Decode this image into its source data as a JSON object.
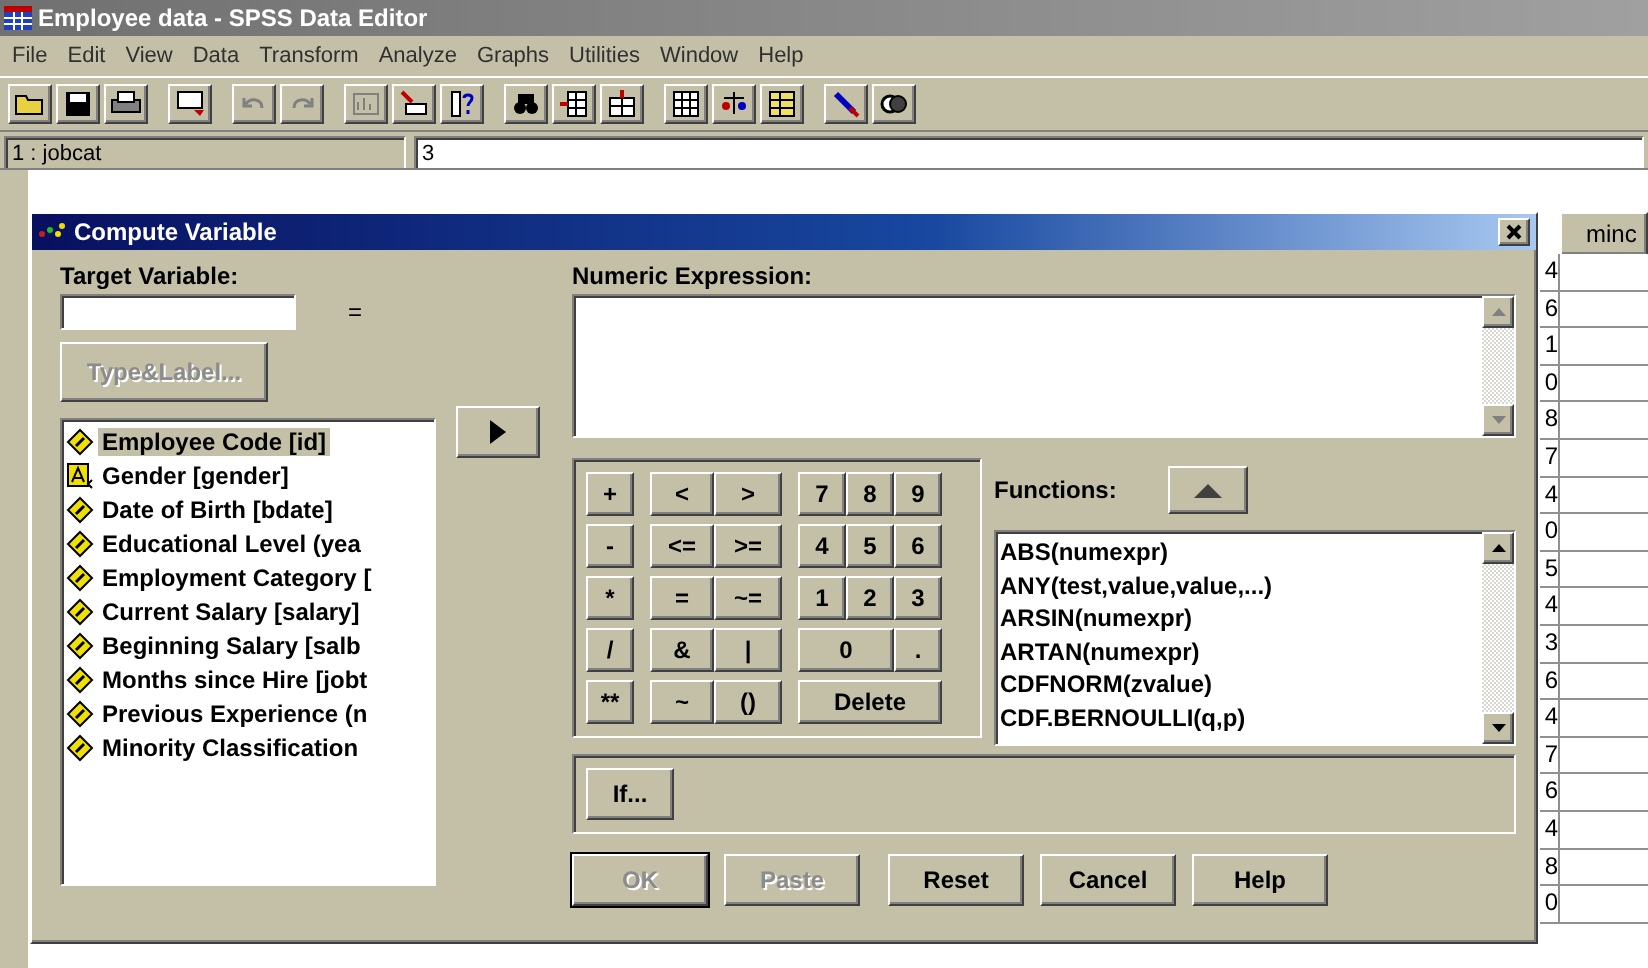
{
  "window": {
    "title": "Employee data - SPSS Data Editor"
  },
  "menu": [
    "File",
    "Edit",
    "View",
    "Data",
    "Transform",
    "Analyze",
    "Graphs",
    "Utilities",
    "Window",
    "Help"
  ],
  "cell_editor": {
    "cell_ref": "1 : jobcat",
    "value": "3"
  },
  "grid": {
    "column_header": "minc",
    "cut_column": [
      "4",
      "6",
      "1",
      "0",
      "8",
      "7",
      "4",
      "0",
      "5",
      "4",
      "3",
      "6",
      "4",
      "7",
      "6",
      "4",
      "8",
      "0"
    ]
  },
  "dialog": {
    "title": "Compute Variable",
    "target_label": "Target Variable:",
    "equals": "=",
    "type_label_button": {
      "label": "Type&Label...",
      "disabled": true
    },
    "variables": [
      {
        "label": "Employee Code [id]",
        "kind": "numeric",
        "selected": true
      },
      {
        "label": "Gender [gender]",
        "kind": "string",
        "selected": false
      },
      {
        "label": "Date of Birth [bdate]",
        "kind": "numeric",
        "selected": false
      },
      {
        "label": "Educational Level (yea",
        "kind": "numeric",
        "selected": false
      },
      {
        "label": "Employment Category [",
        "kind": "numeric",
        "selected": false
      },
      {
        "label": "Current Salary [salary]",
        "kind": "numeric",
        "selected": false
      },
      {
        "label": "Beginning Salary [salb",
        "kind": "numeric",
        "selected": false
      },
      {
        "label": "Months since Hire [jobt",
        "kind": "numeric",
        "selected": false
      },
      {
        "label": "Previous Experience (n",
        "kind": "numeric",
        "selected": false
      },
      {
        "label": "Minority Classification",
        "kind": "numeric",
        "selected": false
      }
    ],
    "expression_label": "Numeric Expression:",
    "keypad": [
      [
        "+",
        "<",
        ">",
        "7",
        "8",
        "9"
      ],
      [
        "-",
        "<=",
        ">=",
        "4",
        "5",
        "6"
      ],
      [
        "*",
        "=",
        "~=",
        "1",
        "2",
        "3"
      ],
      [
        "/",
        "&",
        "|",
        "0",
        "."
      ],
      [
        "**",
        "~",
        "()",
        "Delete"
      ]
    ],
    "functions_label": "Functions:",
    "functions": [
      "ABS(numexpr)",
      "ANY(test,value,value,...)",
      "ARSIN(numexpr)",
      "ARTAN(numexpr)",
      "CDFNORM(zvalue)",
      "CDF.BERNOULLI(q,p)"
    ],
    "if_button": "If...",
    "buttons": [
      {
        "label": "OK",
        "disabled": true,
        "default": true
      },
      {
        "label": "Paste",
        "disabled": true,
        "default": false
      },
      {
        "label": "Reset",
        "disabled": false,
        "default": false
      },
      {
        "label": "Cancel",
        "disabled": false,
        "default": false
      },
      {
        "label": "Help",
        "disabled": false,
        "default": false
      }
    ]
  }
}
